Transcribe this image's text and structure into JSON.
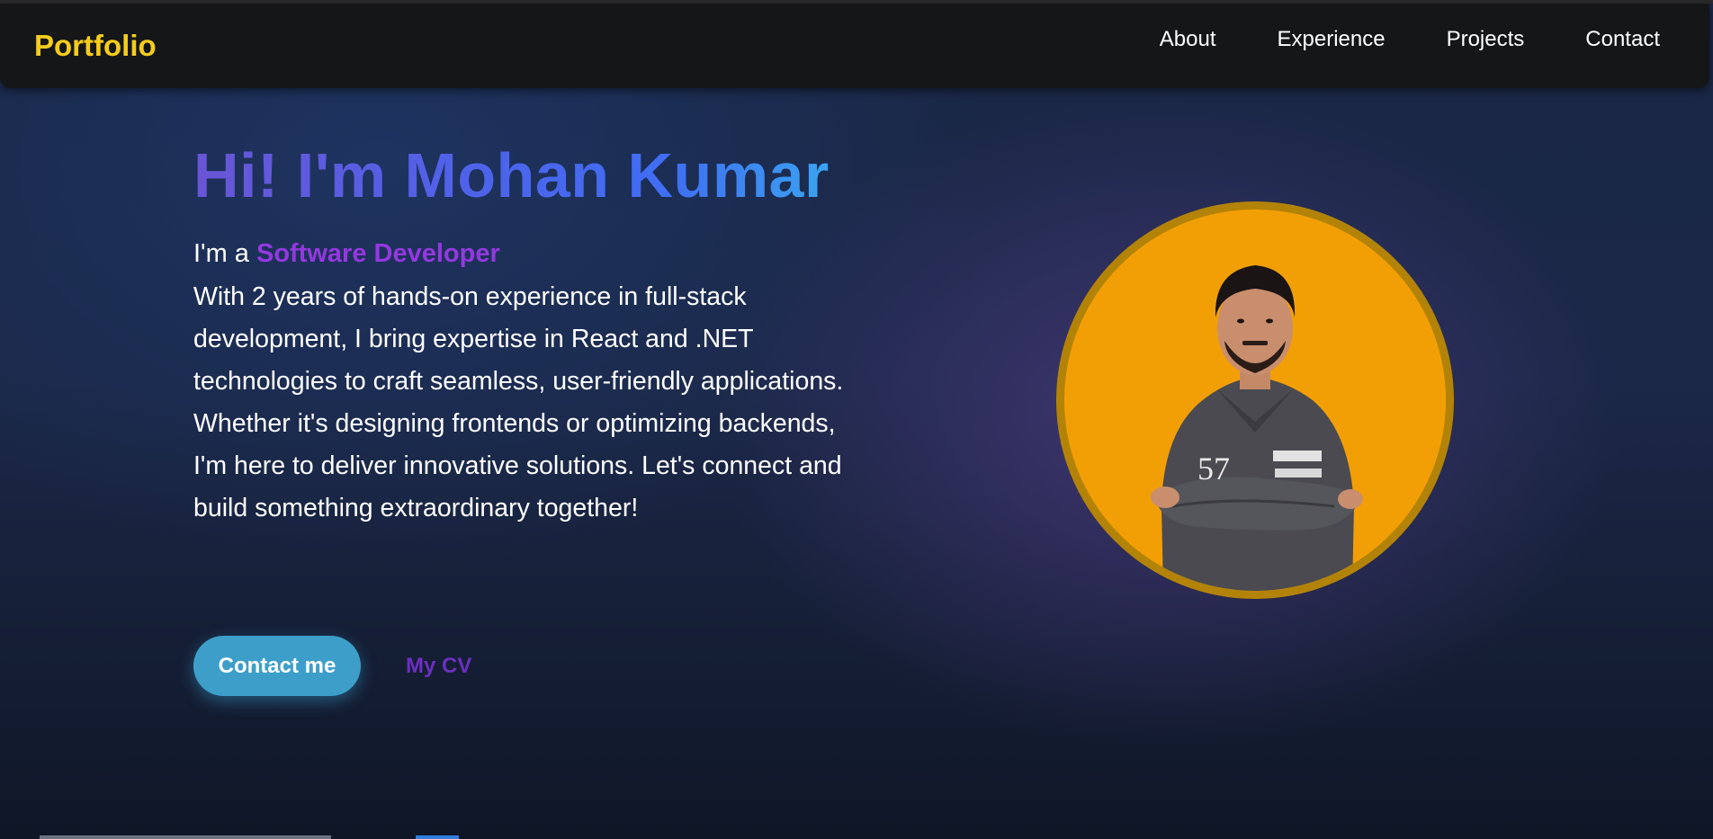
{
  "navbar": {
    "brand": "Portfolio",
    "links": [
      {
        "label": "About"
      },
      {
        "label": "Experience"
      },
      {
        "label": "Projects"
      },
      {
        "label": "Contact"
      }
    ]
  },
  "hero": {
    "title": "Hi! I'm Mohan Kumar",
    "intro_prefix": "I'm a ",
    "role": "Software Developer",
    "bio": "With 2 years of hands-on experience in full-stack development, I bring expertise in React and .NET technologies to craft seamless, user-friendly applications. Whether it's designing frontends or optimizing backends, I'm here to deliver innovative solutions. Let's connect and build something extraordinary together!",
    "contact_button": "Contact me",
    "cv_link": "My CV"
  },
  "colors": {
    "brand": "#f5cc1b",
    "role": "#9438e0",
    "contact_button": "#3d9fc9",
    "cv_link": "#6b2fc0",
    "avatar_bg": "#f29f06",
    "avatar_border": "#b38308"
  },
  "icons": {
    "avatar": "profile-photo"
  }
}
